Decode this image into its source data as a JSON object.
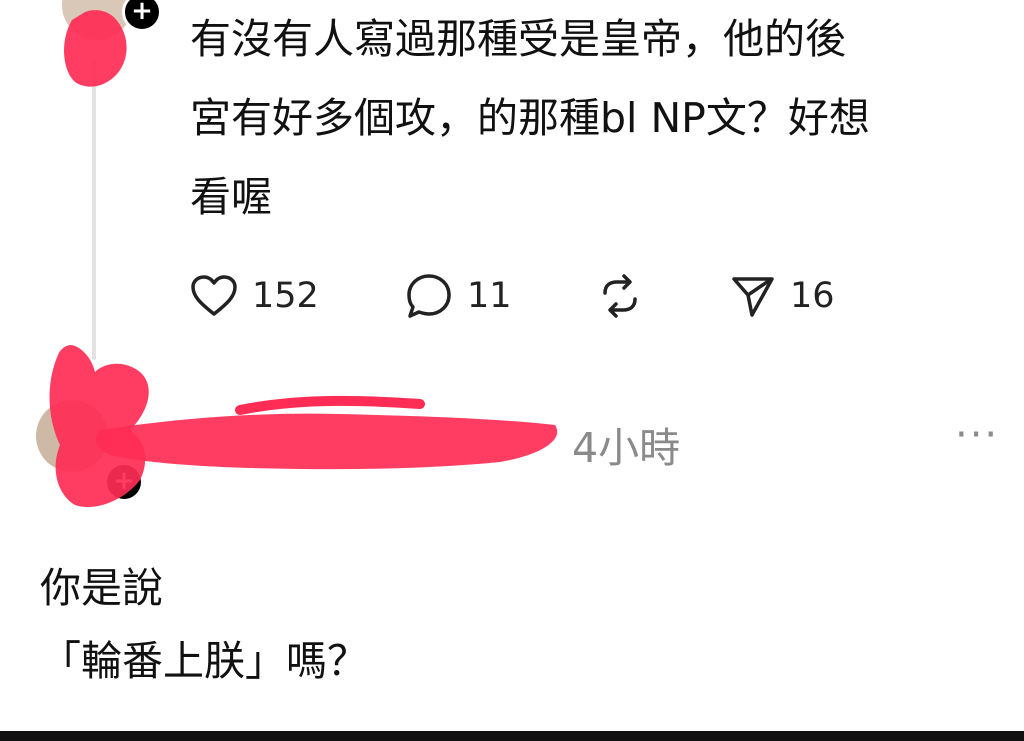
{
  "post": {
    "text": "有沒有人寫過那種受是皇帝，他的後\n宮有好多個攻，的那種bl NP文？好想\n看喔",
    "stats": {
      "likes": "152",
      "replies": "11",
      "shares": "16"
    }
  },
  "reply": {
    "time": "4小時",
    "more": "···",
    "text": "你是說\n「輪番上朕」嗎？"
  },
  "icons": {
    "like": "heart-icon",
    "reply": "speech-bubble-icon",
    "repost": "repost-icon",
    "share": "send-icon",
    "follow": "plus-icon"
  },
  "colors": {
    "redaction": "#ff2d55",
    "muted": "#8a8a8a"
  }
}
